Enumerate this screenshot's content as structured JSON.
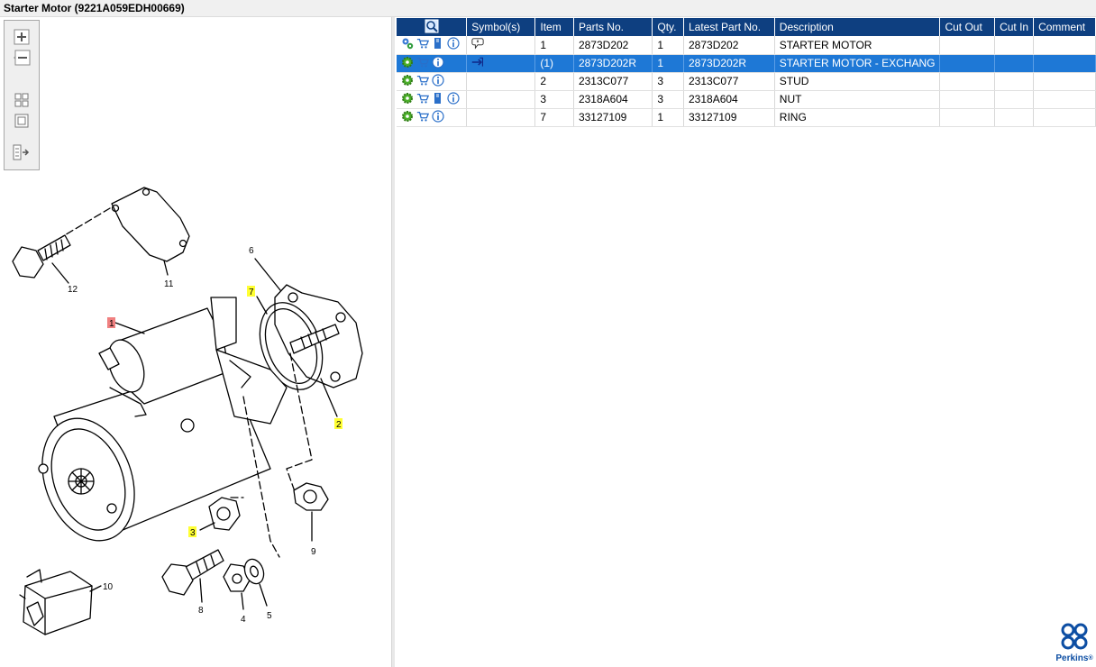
{
  "window": {
    "title": "Starter Motor (9221A059EDH00669)"
  },
  "colors": {
    "header_bg": "#0e3f80",
    "selected_row": "#1e78d6",
    "callout_yellow": "#ffff33",
    "callout_red": "#f08080",
    "brand_blue": "#0d4ea3"
  },
  "zoom_toolbar": {
    "buttons": [
      {
        "name": "zoom-in-icon"
      },
      {
        "name": "zoom-out-icon"
      },
      {
        "name": "fit-all-icon"
      },
      {
        "name": "actual-size-icon"
      },
      {
        "name": "show-list-icon"
      }
    ]
  },
  "diagram": {
    "callouts": [
      {
        "label": "1",
        "highlight": "red"
      },
      {
        "label": "2",
        "highlight": "yellow"
      },
      {
        "label": "3",
        "highlight": "yellow"
      },
      {
        "label": "4",
        "highlight": "none"
      },
      {
        "label": "5",
        "highlight": "none"
      },
      {
        "label": "6",
        "highlight": "none"
      },
      {
        "label": "7",
        "highlight": "yellow"
      },
      {
        "label": "8",
        "highlight": "none"
      },
      {
        "label": "9",
        "highlight": "none"
      },
      {
        "label": "10",
        "highlight": "none"
      },
      {
        "label": "11",
        "highlight": "none"
      },
      {
        "label": "12",
        "highlight": "none"
      }
    ]
  },
  "table": {
    "columns": [
      "",
      "Symbol(s)",
      "Item",
      "Parts No.",
      "Qty.",
      "Latest Part No.",
      "Description",
      "Cut Out",
      "Cut In",
      "Comment"
    ],
    "header_icon": "search-icon",
    "rows": [
      {
        "icons": [
          "gears-icon",
          "cart-icon",
          "book-icon",
          "info-icon"
        ],
        "symbol": "speech-bubble-icon",
        "item": "1",
        "part_no": "2873D202",
        "qty": "1",
        "latest": "2873D202",
        "desc": "STARTER MOTOR",
        "cut_out": "",
        "cut_in": "",
        "comment": "",
        "selected": false
      },
      {
        "icons": [
          "gear-icon",
          "cart-icon",
          "info-icon"
        ],
        "symbol": "exchange-arrow-icon",
        "item": "(1)",
        "part_no": "2873D202R",
        "qty": "1",
        "latest": "2873D202R",
        "desc": "STARTER MOTOR - EXCHANG",
        "cut_out": "",
        "cut_in": "",
        "comment": "",
        "selected": true
      },
      {
        "icons": [
          "gear-icon",
          "cart-icon",
          "info-icon"
        ],
        "symbol": "",
        "item": "2",
        "part_no": "2313C077",
        "qty": "3",
        "latest": "2313C077",
        "desc": "STUD",
        "cut_out": "",
        "cut_in": "",
        "comment": "",
        "selected": false
      },
      {
        "icons": [
          "gear-icon",
          "cart-icon",
          "book-icon",
          "info-icon"
        ],
        "symbol": "",
        "item": "3",
        "part_no": "2318A604",
        "qty": "3",
        "latest": "2318A604",
        "desc": "NUT",
        "cut_out": "",
        "cut_in": "",
        "comment": "",
        "selected": false
      },
      {
        "icons": [
          "gear-icon",
          "cart-icon",
          "info-icon"
        ],
        "symbol": "",
        "item": "7",
        "part_no": "33127109",
        "qty": "1",
        "latest": "33127109",
        "desc": "RING",
        "cut_out": "",
        "cut_in": "",
        "comment": "",
        "selected": false
      }
    ]
  },
  "brand": {
    "name": "Perkins",
    "mark": "®"
  }
}
